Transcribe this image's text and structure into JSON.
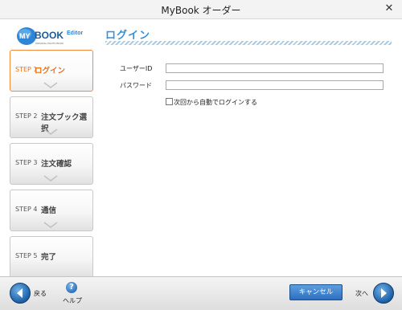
{
  "window": {
    "title": "MyBook オーダー",
    "close_glyph": "✕"
  },
  "logo": {
    "my": "MY",
    "book": "BOOK",
    "editor": "Editor",
    "tagline": "ORIGINAL PHOTO BOOK"
  },
  "page": {
    "title": "ログイン"
  },
  "steps": [
    {
      "num": "STEP 1",
      "label": "ログイン",
      "active": true
    },
    {
      "num": "STEP 2",
      "label": "注文ブック選択",
      "active": false
    },
    {
      "num": "STEP 3",
      "label": "注文確認",
      "active": false
    },
    {
      "num": "STEP 4",
      "label": "通信",
      "active": false
    },
    {
      "num": "STEP 5",
      "label": "完了",
      "active": false
    }
  ],
  "form": {
    "user_id_label": "ユーザーID",
    "user_id_value": "",
    "password_label": "パスワード",
    "password_value": "",
    "auto_login_label": "次回から自動でログインする",
    "auto_login_checked": false
  },
  "toolbar": {
    "back_label": "戻る",
    "help_label": "ヘルプ",
    "help_glyph": "?",
    "cancel_label": "キャンセル",
    "next_label": "次へ"
  },
  "colors": {
    "accent": "#3a8fd4",
    "active_step": "#e8721c",
    "button_blue": "#2d6fbf"
  }
}
